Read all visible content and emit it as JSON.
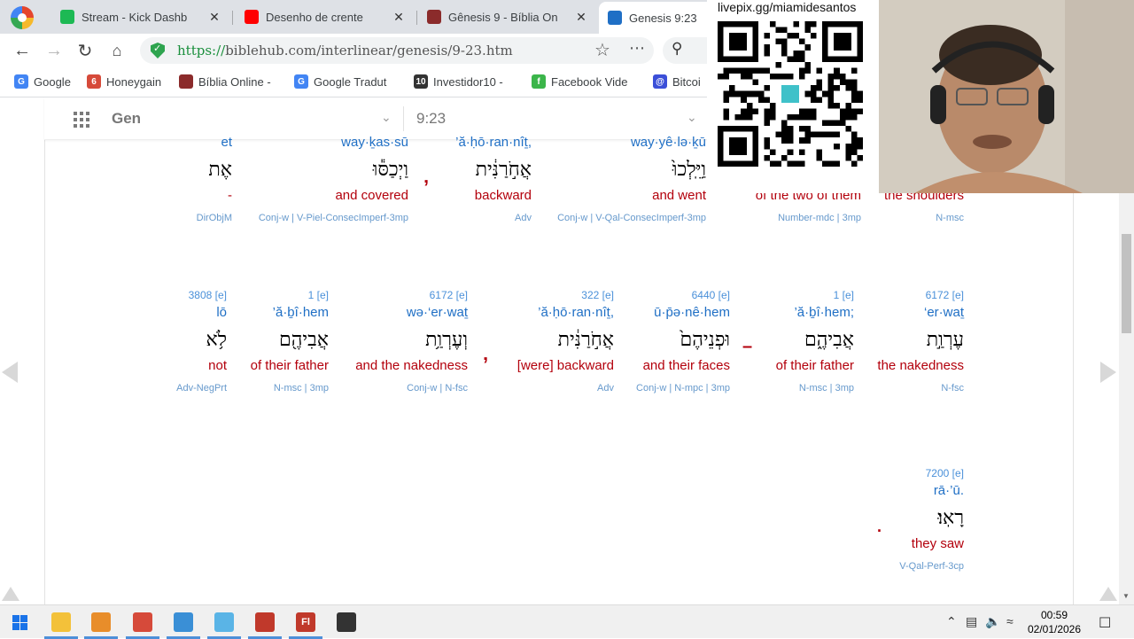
{
  "browser": {
    "tabs": [
      {
        "title": "Stream - Kick Dashb",
        "icon": "kick-icon",
        "color": "#1db954",
        "active": false
      },
      {
        "title": "Desenho de crente",
        "icon": "youtube-icon",
        "color": "#ff0000",
        "active": false
      },
      {
        "title": "Gênesis 9 - Bíblia On",
        "icon": "bible-icon",
        "color": "#8b2b2b",
        "active": false
      },
      {
        "title": "Genesis 9:23",
        "icon": "biblehub-icon",
        "color": "#1f6fc5",
        "active": true
      }
    ],
    "url": {
      "scheme": "https://",
      "rest": "biblehub.com/interlinear/genesis/9-23.htm"
    },
    "bookmarks": [
      {
        "label": "Google",
        "icon": "google-icon",
        "color": "#4285f4",
        "glyph": "G"
      },
      {
        "label": "Honeygain",
        "icon": "honeygain-icon",
        "color": "#d64a3a",
        "glyph": "6"
      },
      {
        "label": "Bíblia Online -",
        "icon": "bible-icon",
        "color": "#8b2b2b",
        "glyph": ""
      },
      {
        "label": "Google Tradut",
        "icon": "translate-icon",
        "color": "#4285f4",
        "glyph": "G"
      },
      {
        "label": "Investidor10 -",
        "icon": "investidor-icon",
        "color": "#333333",
        "glyph": "10"
      },
      {
        "label": "Facebook Vide",
        "icon": "facebook-icon",
        "color": "#3bb54a",
        "glyph": "f"
      },
      {
        "label": "Bitcoi",
        "icon": "bitcoin-icon",
        "color": "#3b4fd8",
        "glyph": "@"
      }
    ]
  },
  "nav": {
    "book": "Gen",
    "verse": "9:23"
  },
  "interlinear": {
    "row1": [
      {
        "strong": "",
        "translit": "et",
        "hebrew": "אֶת",
        "english": "-",
        "pos": "DirObjM"
      },
      {
        "strong": "",
        "translit": "way·ḵas·sū",
        "hebrew": "וַיְכַסּ֕וּ",
        "english": "and covered",
        "pos": "Conj-w | V-Piel-ConsecImperf-3mp"
      },
      {
        "strong": "",
        "translit": "’ă·ḥō·ran·nîṯ,",
        "hebrew": "אֲחֹ֣רַנִּ֔ית",
        "english": "backward",
        "pos": "Adv"
      },
      {
        "strong": "",
        "translit": "way·yê·lə·ḵū",
        "hebrew": "וַיֵּֽלְכוּ֙",
        "english": "and went",
        "pos": "Conj-w | V-Qal-ConsecImperf-3mp"
      },
      {
        "strong": "",
        "translit": "",
        "hebrew": "",
        "english": "of the two of them",
        "pos": "Number-mdc | 3mp"
      },
      {
        "strong": "",
        "translit": "",
        "hebrew": "",
        "english": "the shoulders",
        "pos": "N-msc"
      }
    ],
    "row2": [
      {
        "strong": "3808 [e]",
        "translit": "lō",
        "hebrew": "לֹ֥א",
        "english": "not",
        "pos": "Adv-NegPrt"
      },
      {
        "strong": "1 [e]",
        "translit": "’ă·ḇî·hem",
        "hebrew": "אֲבִיהֶ֖ם",
        "english": "of their father",
        "pos": "N-msc | 3mp"
      },
      {
        "strong": "6172 [e]",
        "translit": "wə·‘er·waṯ",
        "hebrew": "וְעֶרְוַ֥ת",
        "english": "and the nakedness",
        "pos": "Conj-w | N-fsc"
      },
      {
        "strong": "322 [e]",
        "translit": "’ă·ḥō·ran·nîṯ,",
        "hebrew": "אֲחֹ֣רַנִּ֔ית",
        "english": "[were] backward",
        "pos": "Adv"
      },
      {
        "strong": "6440 [e]",
        "translit": "ū·p̄ə·nê·hem",
        "hebrew": "וּפְנֵיהֶם֙",
        "english": "and their faces",
        "pos": "Conj-w | N-mpc | 3mp"
      },
      {
        "strong": "1 [e]",
        "translit": "’ă·ḇî·hem;",
        "hebrew": "אֲבִיהֶ֑ם",
        "english": "of their father",
        "pos": "N-msc | 3mp"
      },
      {
        "strong": "6172 [e]",
        "translit": "‘er·waṯ",
        "hebrew": "עֶרְוַ֣ת",
        "english": "the nakedness",
        "pos": "N-fsc"
      }
    ],
    "row3": [
      {
        "strong": "7200 [e]",
        "translit": "rā·’ū.",
        "hebrew": "רָאֽוּ׃",
        "english": "they saw",
        "pos": "V-Qal-Perf-3cp"
      }
    ]
  },
  "overlay": {
    "qr_caption": "livepix.gg/miamidesantos"
  },
  "taskbar": {
    "apps": [
      {
        "name": "file-explorer-icon",
        "color": "#f3c13a",
        "glyph": ""
      },
      {
        "name": "media-icon",
        "color": "#e88d2a",
        "glyph": ""
      },
      {
        "name": "chrome-icon",
        "color": "#d64a3a",
        "glyph": ""
      },
      {
        "name": "paint-icon",
        "color": "#3a8fd6",
        "glyph": ""
      },
      {
        "name": "notepad-icon",
        "color": "#5ab4e6",
        "glyph": ""
      },
      {
        "name": "calculator-icon",
        "color": "#c0392b",
        "glyph": ""
      },
      {
        "name": "fl-studio-icon",
        "color": "#c0392b",
        "glyph": "Fl"
      },
      {
        "name": "obs-icon",
        "color": "#333333",
        "glyph": ""
      }
    ],
    "time": "00:59",
    "date": "02/01/2026"
  }
}
